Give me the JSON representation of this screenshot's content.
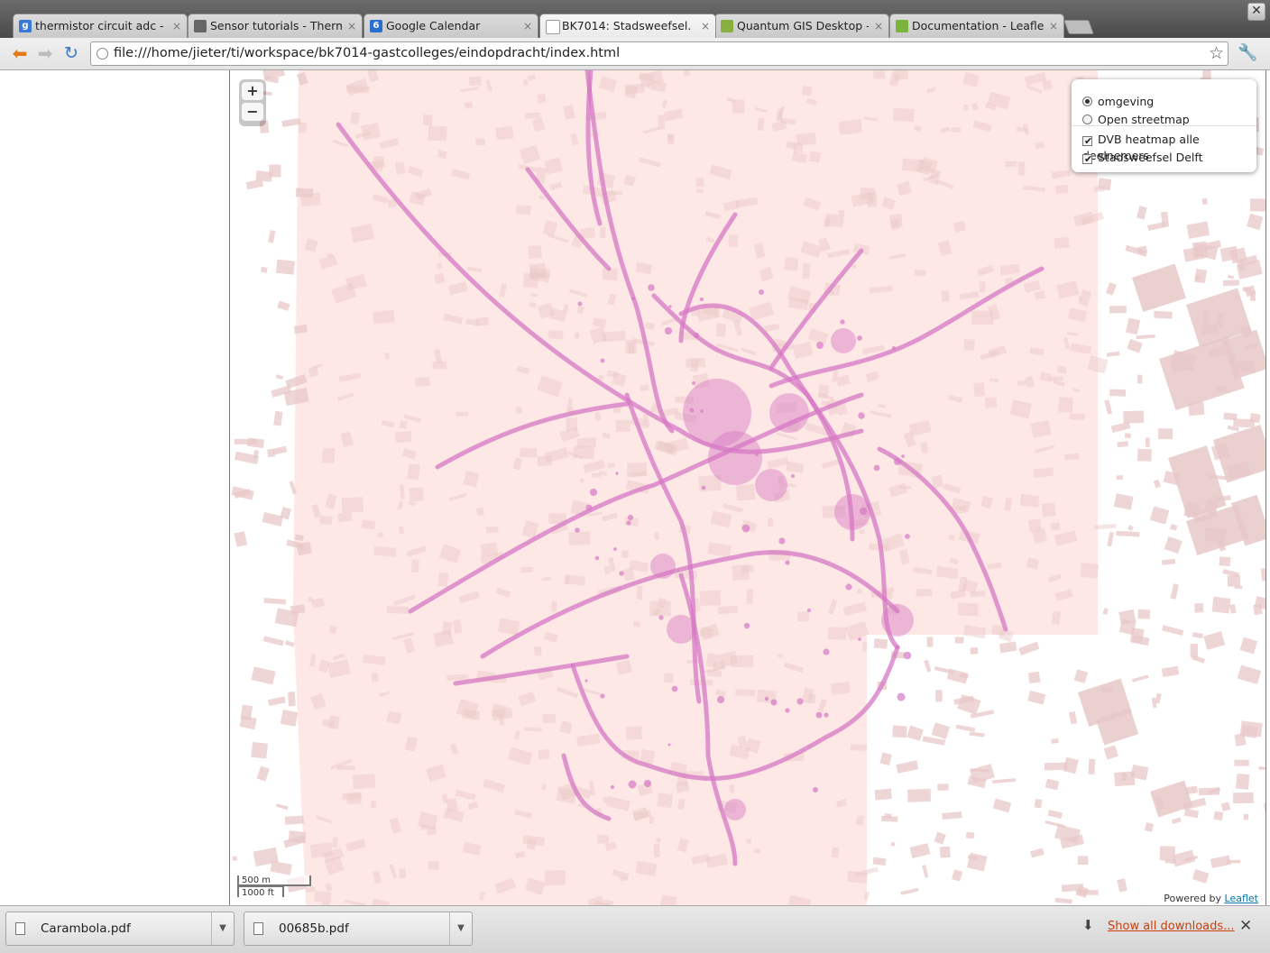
{
  "browser": {
    "tabs": [
      {
        "title": "thermistor circuit adc - Go",
        "favicon": "google-icon",
        "favicon_text": "g",
        "color": "#3a78d8"
      },
      {
        "title": "Sensor tutorials - Thermis",
        "favicon": "sensor-tutorials-icon",
        "favicon_text": "",
        "color": "#666666"
      },
      {
        "title": "Google Calendar",
        "favicon": "calendar-icon",
        "favicon_text": "6",
        "color": "#2a6fd0"
      },
      {
        "title": "BK7014: Stadsweefsel.",
        "favicon": "page-icon",
        "favicon_text": "",
        "color": "#ffffff"
      },
      {
        "title": "Quantum GIS Desktop - Ne",
        "favicon": "qgis-icon",
        "favicon_text": "",
        "color": "#88b040"
      },
      {
        "title": "Documentation - Leaflet -",
        "favicon": "leaflet-icon",
        "favicon_text": "",
        "color": "#7ab33b"
      }
    ],
    "active_tab_index": 3,
    "url": "file:///home/jieter/ti/workspace/bk7014-gastcolleges/eindopdracht/index.html"
  },
  "map": {
    "zoom_in_label": "+",
    "zoom_out_label": "−",
    "layers": {
      "base": [
        {
          "label": "omgeving",
          "selected": true
        },
        {
          "label": "Open streetmap",
          "selected": false
        }
      ],
      "overlays": [
        {
          "label": "DVB heatmap alle deelnemers",
          "checked": true
        },
        {
          "label": "Stadsweefsel Delft",
          "checked": true
        }
      ]
    },
    "scale": {
      "metric": "500 m",
      "imperial": "1000 ft"
    },
    "attribution": {
      "prefix": "Powered by ",
      "link": "Leaflet"
    },
    "colors": {
      "heat": "#d678c4",
      "buildings": "#e8c8c8",
      "overlay": "#fde8e6"
    }
  },
  "downloads": {
    "items": [
      {
        "name": "Carambola.pdf"
      },
      {
        "name": "00685b.pdf"
      }
    ],
    "show_all": "Show all downloads..."
  }
}
